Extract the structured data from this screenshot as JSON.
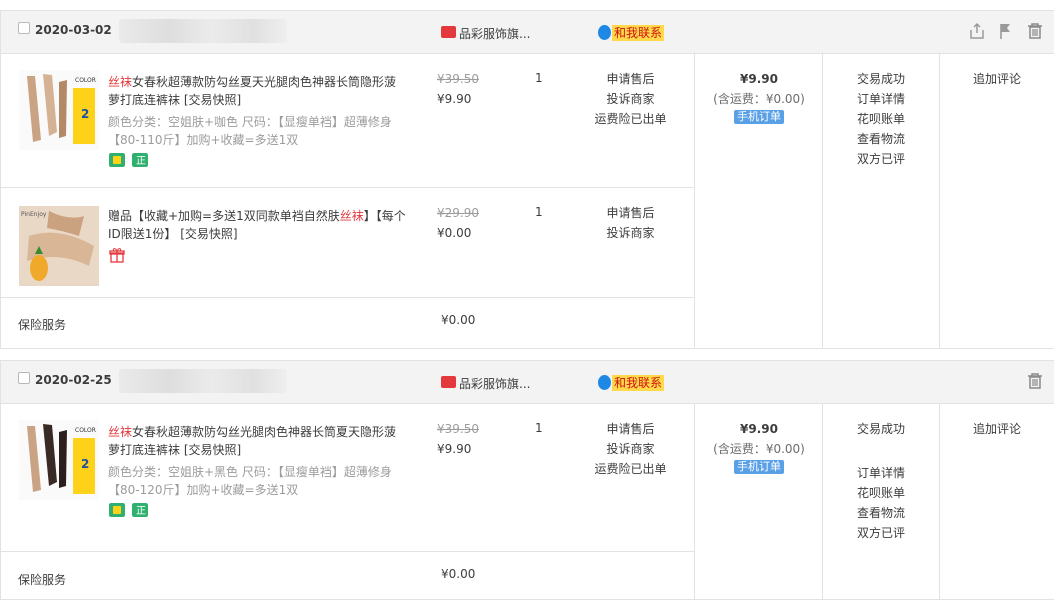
{
  "orders": [
    {
      "date": "2020-03-02",
      "shop": "品彩服饰旗...",
      "contact": "和我联系",
      "items": [
        {
          "title_kw": "丝袜",
          "title_rest": "女春秋超薄款防勾丝夏天光腿肉色神器长筒隐形菠萝打底连裤袜 [交易快照]",
          "attrs": "颜色分类：空姐肤+咖色  尺码：【显瘦单裆】超薄修身【80-110斤】加购+收藏=多送1双",
          "orig_price": "¥39.50",
          "price": "¥9.90",
          "qty": "1",
          "ops": [
            "申请售后",
            "投诉商家",
            "运费险已出单"
          ]
        },
        {
          "title_pre": "赠品【收藏+加购=多送1双同款单裆自然肤",
          "title_kw": "丝袜",
          "title_post": "】【每个ID限送1份】 [交易快照]",
          "orig_price": "¥29.90",
          "price": "¥0.00",
          "qty": "1",
          "ops": [
            "申请售后",
            "投诉商家"
          ]
        }
      ],
      "insurance_label": "保险服务",
      "insurance_price": "¥0.00",
      "total": "¥9.90",
      "shipping": "(含运费：¥0.00)",
      "mobile_tag": "手机订单",
      "status": [
        "交易成功",
        "订单详情",
        "花呗账单",
        "查看物流",
        "双方已评"
      ],
      "review": "追加评论"
    },
    {
      "date": "2020-02-25",
      "shop": "品彩服饰旗...",
      "contact": "和我联系",
      "items": [
        {
          "title_kw": "丝袜",
          "title_rest": "女春秋超薄款防勾丝光腿肉色神器长筒夏天隐形菠萝打底连裤袜 [交易快照]",
          "attrs": "颜色分类：空姐肤+黑色  尺码：【显瘦单裆】超薄修身【80-120斤】加购+收藏=多送1双",
          "orig_price": "¥39.50",
          "price": "¥9.90",
          "qty": "1",
          "ops": [
            "申请售后",
            "投诉商家",
            "运费险已出单"
          ]
        }
      ],
      "insurance_label": "保险服务",
      "insurance_price": "¥0.00",
      "total": "¥9.90",
      "shipping": "(含运费：¥0.00)",
      "mobile_tag": "手机订单",
      "status": [
        "交易成功",
        "订单详情",
        "花呗账单",
        "查看物流",
        "双方已评"
      ],
      "review": "追加评论"
    }
  ],
  "icons": {
    "shop": "tmall-icon",
    "contact": "wangwang-icon",
    "share": "share-icon",
    "flag": "flag-icon",
    "delete": "trash-icon"
  },
  "colors": {
    "keyword": "#e4393c",
    "header_bg": "#f3f3f3",
    "mobile_tag": "#5aa0e6",
    "contact_bg": "#ffd94a"
  }
}
